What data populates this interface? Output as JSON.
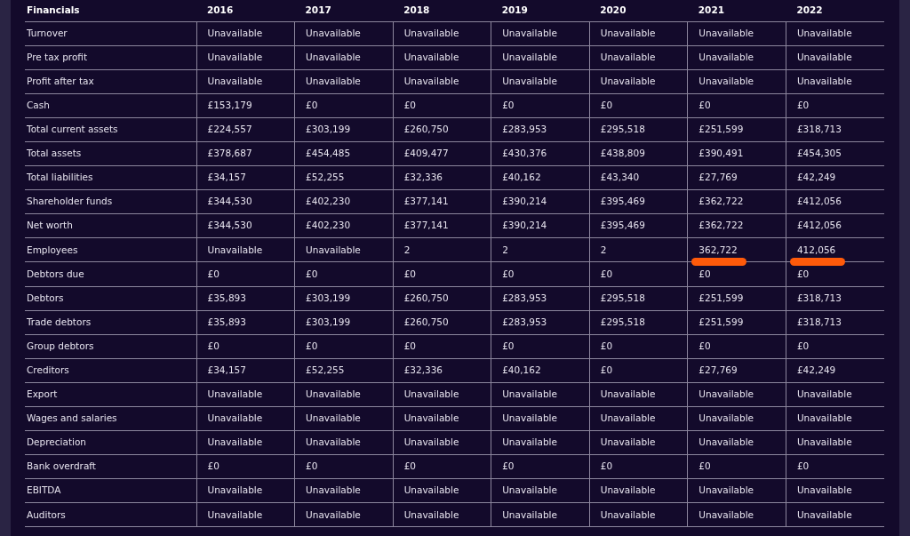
{
  "table": {
    "columns": [
      "Financials",
      "2016",
      "2017",
      "2018",
      "2019",
      "2020",
      "2021",
      "2022"
    ],
    "rows": [
      {
        "cells": [
          "Turnover",
          "Unavailable",
          "Unavailable",
          "Unavailable",
          "Unavailable",
          "Unavailable",
          "Unavailable",
          "Unavailable"
        ]
      },
      {
        "cells": [
          "Pre tax profit",
          "Unavailable",
          "Unavailable",
          "Unavailable",
          "Unavailable",
          "Unavailable",
          "Unavailable",
          "Unavailable"
        ]
      },
      {
        "cells": [
          "Profit after tax",
          "Unavailable",
          "Unavailable",
          "Unavailable",
          "Unavailable",
          "Unavailable",
          "Unavailable",
          "Unavailable"
        ]
      },
      {
        "cells": [
          "Cash",
          "£153,179",
          "£0",
          "£0",
          "£0",
          "£0",
          "£0",
          "£0"
        ]
      },
      {
        "cells": [
          "Total current assets",
          "£224,557",
          "£303,199",
          "£260,750",
          "£283,953",
          "£295,518",
          "£251,599",
          "£318,713"
        ]
      },
      {
        "cells": [
          "Total assets",
          "£378,687",
          "£454,485",
          "£409,477",
          "£430,376",
          "£438,809",
          "£390,491",
          "£454,305"
        ]
      },
      {
        "cells": [
          "Total liabilities",
          "£34,157",
          "£52,255",
          "£32,336",
          "£40,162",
          "£43,340",
          "£27,769",
          "£42,249"
        ]
      },
      {
        "cells": [
          "Shareholder funds",
          "£344,530",
          "£402,230",
          "£377,141",
          "£390,214",
          "£395,469",
          "£362,722",
          "£412,056"
        ]
      },
      {
        "cells": [
          "Net worth",
          "£344,530",
          "£402,230",
          "£377,141",
          "£390,214",
          "£395,469",
          "£362,722",
          "£412,056"
        ]
      },
      {
        "cells": [
          "Employees",
          "Unavailable",
          "Unavailable",
          "2",
          "2",
          "2",
          {
            "text": "362,722",
            "marked": true
          },
          {
            "text": "412,056",
            "marked": true
          }
        ]
      },
      {
        "cells": [
          "Debtors due",
          "£0",
          "£0",
          "£0",
          "£0",
          "£0",
          "£0",
          "£0"
        ]
      },
      {
        "cells": [
          "Debtors",
          "£35,893",
          "£303,199",
          "£260,750",
          "£283,953",
          "£295,518",
          "£251,599",
          "£318,713"
        ]
      },
      {
        "cells": [
          "Trade debtors",
          "£35,893",
          "£303,199",
          "£260,750",
          "£283,953",
          "£295,518",
          "£251,599",
          "£318,713"
        ]
      },
      {
        "cells": [
          "Group debtors",
          "£0",
          "£0",
          "£0",
          "£0",
          "£0",
          "£0",
          "£0"
        ]
      },
      {
        "cells": [
          "Creditors",
          "£34,157",
          "£52,255",
          "£32,336",
          "£40,162",
          "£0",
          "£27,769",
          "£42,249"
        ]
      },
      {
        "cells": [
          "Export",
          "Unavailable",
          "Unavailable",
          "Unavailable",
          "Unavailable",
          "Unavailable",
          "Unavailable",
          "Unavailable"
        ]
      },
      {
        "cells": [
          "Wages and salaries",
          "Unavailable",
          "Unavailable",
          "Unavailable",
          "Unavailable",
          "Unavailable",
          "Unavailable",
          "Unavailable"
        ]
      },
      {
        "cells": [
          "Depreciation",
          "Unavailable",
          "Unavailable",
          "Unavailable",
          "Unavailable",
          "Unavailable",
          "Unavailable",
          "Unavailable"
        ]
      },
      {
        "cells": [
          "Bank overdraft",
          "£0",
          "£0",
          "£0",
          "£0",
          "£0",
          "£0",
          "£0"
        ]
      },
      {
        "cells": [
          "EBITDA",
          "Unavailable",
          "Unavailable",
          "Unavailable",
          "Unavailable",
          "Unavailable",
          "Unavailable",
          "Unavailable"
        ]
      },
      {
        "cells": [
          "Auditors",
          "Unavailable",
          "Unavailable",
          "Unavailable",
          "Unavailable",
          "Unavailable",
          "Unavailable",
          "Unavailable"
        ]
      }
    ]
  }
}
